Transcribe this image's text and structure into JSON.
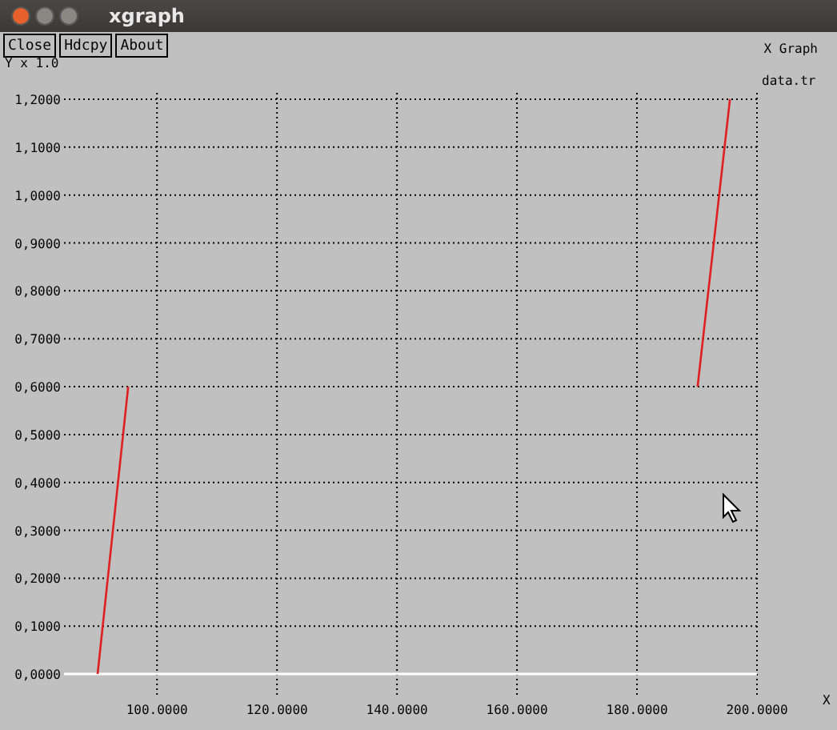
{
  "window": {
    "title": "xgraph"
  },
  "buttons": [
    "Close",
    "Hdcpy",
    "About"
  ],
  "graph_title": "X Graph",
  "y_unit_label": "Y x 1.0",
  "x_axis_label": "X",
  "chart_data": {
    "type": "line",
    "x": [
      90.1,
      95.2,
      95.3,
      190.1,
      195.5
    ],
    "series": [
      {
        "name": "data.tr",
        "color": "#e02020",
        "values": [
          0,
          0.6,
          null,
          0.6,
          1.2
        ]
      }
    ],
    "xlim": [
      84.5,
      200
    ],
    "ylim": [
      -0.05,
      1.2
    ],
    "grid": true,
    "xticks": [
      {
        "value": 100,
        "label": "100.0000"
      },
      {
        "value": 120,
        "label": "120.0000"
      },
      {
        "value": 140,
        "label": "140.0000"
      },
      {
        "value": 160,
        "label": "160.0000"
      },
      {
        "value": 180,
        "label": "180.0000"
      },
      {
        "value": 200,
        "label": "200.0000"
      }
    ],
    "yticks": [
      {
        "value": 0,
        "label": "0,0000"
      },
      {
        "value": 0.1,
        "label": "0,1000"
      },
      {
        "value": 0.2,
        "label": "0,2000"
      },
      {
        "value": 0.3,
        "label": "0,3000"
      },
      {
        "value": 0.4,
        "label": "0,4000"
      },
      {
        "value": 0.5,
        "label": "0,5000"
      },
      {
        "value": 0.6,
        "label": "0,6000"
      },
      {
        "value": 0.7,
        "label": "0,7000"
      },
      {
        "value": 0.8,
        "label": "0,8000"
      },
      {
        "value": 0.9,
        "label": "0,9000"
      },
      {
        "value": 1.0,
        "label": "1,0000"
      },
      {
        "value": 1.1,
        "label": "1,1000"
      },
      {
        "value": 1.2,
        "label": "1,2000"
      }
    ]
  }
}
